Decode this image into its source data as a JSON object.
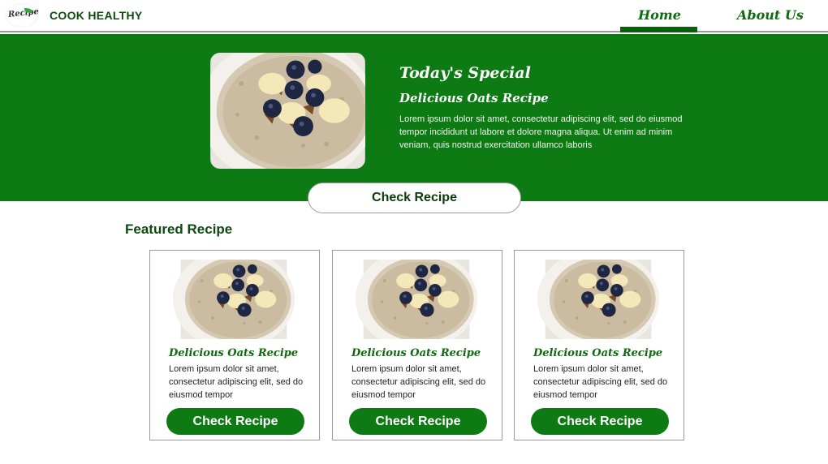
{
  "header": {
    "logo_text": "Recipe",
    "brand": "COOK HEALTHY",
    "nav": {
      "home": "Home",
      "about": "About Us"
    }
  },
  "hero": {
    "title": "Today's Special",
    "subtitle": "Delicious Oats Recipe",
    "text": "Lorem ipsum dolor sit amet, consectetur adipiscing elit, sed do eiusmod tempor incididunt ut labore et dolore magna aliqua. Ut enim ad minim veniam, quis nostrud exercitation ullamco laboris",
    "button_label": "Check Recipe"
  },
  "featured": {
    "heading": "Featured Recipe",
    "cards": [
      {
        "title": "Delicious Oats Recipe",
        "text": "Lorem ipsum dolor sit amet, consectetur adipiscing elit, sed do eiusmod tempor",
        "button_label": "Check Recipe"
      },
      {
        "title": "Delicious Oats Recipe",
        "text": "Lorem ipsum dolor sit amet, consectetur adipiscing elit, sed do eiusmod tempor",
        "button_label": "Check Recipe"
      },
      {
        "title": "Delicious Oats Recipe",
        "text": "Lorem ipsum dolor sit amet, consectetur adipiscing elit, sed do eiusmod tempor",
        "button_label": "Check Recipe"
      }
    ]
  },
  "colors": {
    "primary_green": "#0e7a13",
    "dark_green": "#0d4a0d",
    "nav_underline": "#0b5e0b"
  },
  "icons": {
    "logo": "recipe-logo-icon",
    "food_image": "oatmeal-bowl-image"
  }
}
